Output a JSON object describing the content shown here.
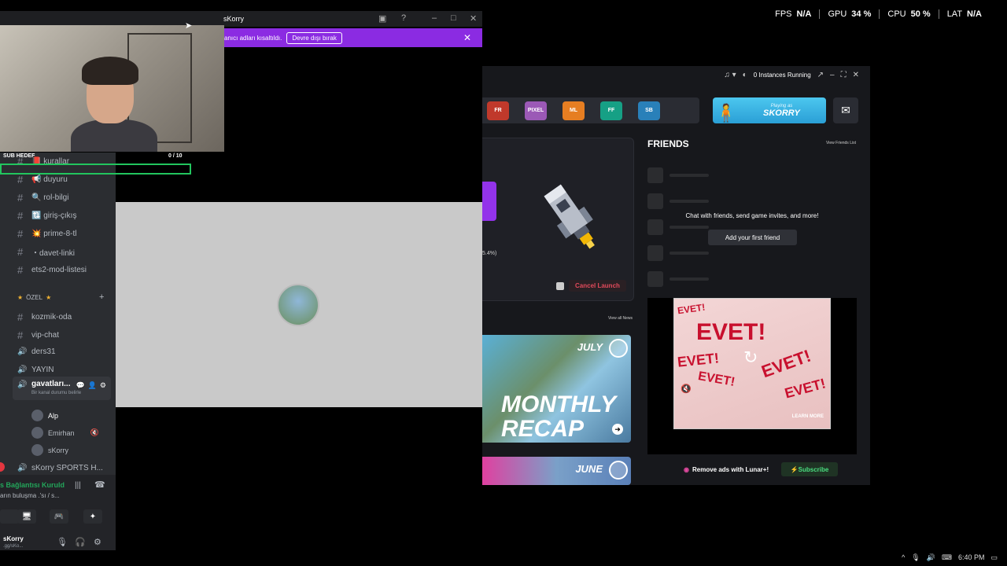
{
  "stats": [
    {
      "label": "FPS",
      "value": "N/A"
    },
    {
      "label": "GPU",
      "value": "34 %"
    },
    {
      "label": "CPU",
      "value": "50 %"
    },
    {
      "label": "LAT",
      "value": "N/A"
    }
  ],
  "discord": {
    "window_title": "sKorry",
    "notice_text": "anıcı adları kısaltıldı.",
    "notice_button": "Devre dışı bırak",
    "channels": [
      {
        "icon": "#",
        "label": "📕 kurallar"
      },
      {
        "icon": "#",
        "label": "📢 duyuru"
      },
      {
        "icon": "#",
        "label": "🔍 rol-bilgi"
      },
      {
        "icon": "#",
        "label": "🔃 giriş-çıkış"
      },
      {
        "icon": "#",
        "label": "💥 prime-8-tl"
      },
      {
        "icon": "#",
        "label": "・davet-linki"
      },
      {
        "icon": "#",
        "label": "ets2-mod-listesi"
      }
    ],
    "category": "ÖZEL",
    "private_channels": [
      {
        "icon": "#",
        "label": "kozmik-oda"
      },
      {
        "icon": "#",
        "label": "vip-chat"
      },
      {
        "icon": "🔊",
        "label": "ders31"
      },
      {
        "icon": "🔊",
        "label": "YAYIN"
      }
    ],
    "active_voice": {
      "name": "gavatları...",
      "status": "Bir kanal durumu belirle"
    },
    "members": [
      "Alp",
      "Emirhan",
      "sKorry"
    ],
    "other_voice": "sKorry SPORTS H...",
    "rtc": {
      "status": "s Bağlantısı Kuruld",
      "channel": "arın buluşma .'sı / s..."
    },
    "user": {
      "name": "sKorry",
      "status": ".gg/sKo..."
    }
  },
  "overlay": {
    "sub_label": "SUB HEDEF",
    "sub_count": "0  / 10",
    "sub_progress": 0
  },
  "lunar": {
    "instances": "0 Instances Running",
    "games": [
      "FR",
      "PIXEL",
      "ML",
      "FF",
      "SB"
    ],
    "playing_as": "Playing as",
    "username": "SKORRY",
    "launch_pct": "5.4%)",
    "cancel_launch": "Cancel Launch",
    "friends_title": "FRIENDS",
    "view_friends": "View Friends List",
    "friends_empty": "Chat with friends, send game invites, and more!",
    "add_friend": "Add your first friend",
    "view_news": "View all News",
    "news": [
      {
        "month": "JULY",
        "line1": "MONTHLY",
        "line2": "RECAP"
      },
      {
        "month": "JUNE"
      }
    ],
    "ad_word": "EVET!",
    "ad_learn_more": "LEARN MORE",
    "remove_ads": "Remove ads with Lunar+!",
    "subscribe": "Subscribe"
  },
  "taskbar": {
    "time": "6:40 PM"
  }
}
